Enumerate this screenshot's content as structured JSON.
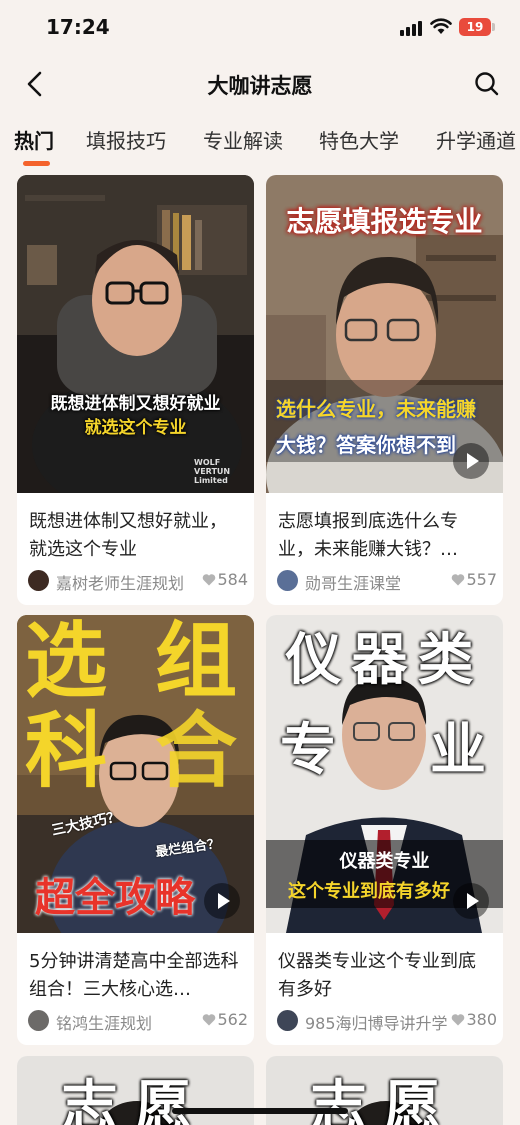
{
  "status": {
    "time": "17:24",
    "battery": "19"
  },
  "nav": {
    "title": "大咖讲志愿"
  },
  "tabs": [
    {
      "label": "热门",
      "active": true
    },
    {
      "label": "填报技巧"
    },
    {
      "label": "专业解读"
    },
    {
      "label": "特色大学"
    },
    {
      "label": "升学通道"
    }
  ],
  "cards": [
    {
      "title": "既想进体制又想好就业，就选这个专业",
      "author": "嘉树老师生涯规划",
      "likes": "584",
      "overlay": [
        "既想进体制又想好就业",
        "就选这个专业"
      ],
      "shirt_text": [
        "WOLF",
        "VERTUN",
        "Limited"
      ]
    },
    {
      "title": "志愿填报到底选什么专业，未来能赚大钱？…",
      "author": "勋哥生涯课堂",
      "likes": "557",
      "overlay": [
        "志愿填报选专业",
        "选什么专业，未来能赚",
        "大钱？答案你想不到"
      ]
    },
    {
      "title": "5分钟讲清楚高中全部选科组合！三大核心选…",
      "author": "铭鸿生涯规划",
      "likes": "562",
      "overlay": [
        "选",
        "组",
        "科",
        "合",
        "三大技巧？",
        "最烂组合？",
        "超全攻略"
      ]
    },
    {
      "title": "仪器类专业这个专业到底有多好",
      "author": "985海归博导讲升学",
      "likes": "380",
      "overlay": [
        "仪器类",
        "专",
        "业",
        "仪器类专业",
        "这个专业到底有多好"
      ]
    },
    {
      "overlay": [
        "志愿"
      ]
    },
    {
      "overlay": [
        "志愿"
      ]
    }
  ],
  "colors": {
    "accent": "#f4622b",
    "background": "#f7f2ee"
  }
}
